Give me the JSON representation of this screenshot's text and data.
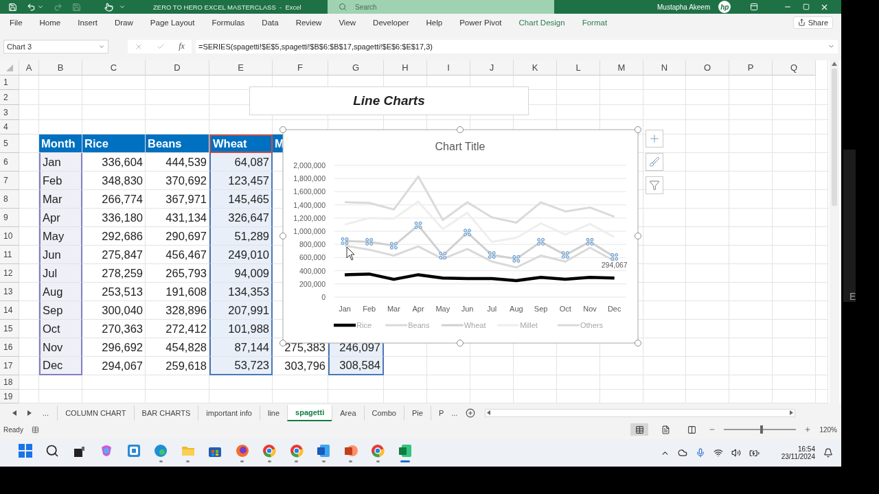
{
  "title_bar": {
    "title": "ZERO TO HERO EXCEL MASTERCLASS  -  Excel",
    "search_placeholder": "Search",
    "user_name": "Mustapha Akeem",
    "account_logo": "hp"
  },
  "ribbon": {
    "tabs": [
      {
        "label": "File",
        "kind": "standard"
      },
      {
        "label": "Home",
        "kind": "standard"
      },
      {
        "label": "Insert",
        "kind": "standard"
      },
      {
        "label": "Draw",
        "kind": "standard"
      },
      {
        "label": "Page Layout",
        "kind": "standard"
      },
      {
        "label": "Formulas",
        "kind": "standard"
      },
      {
        "label": "Data",
        "kind": "standard"
      },
      {
        "label": "Review",
        "kind": "standard"
      },
      {
        "label": "View",
        "kind": "standard"
      },
      {
        "label": "Developer",
        "kind": "standard"
      },
      {
        "label": "Help",
        "kind": "standard"
      },
      {
        "label": "Power Pivot",
        "kind": "standard"
      },
      {
        "label": "Chart Design",
        "kind": "contextual"
      },
      {
        "label": "Format",
        "kind": "contextual"
      }
    ],
    "share": "Share"
  },
  "formula_bar": {
    "name_box": "Chart 3",
    "fx": "fx",
    "formula": "=SERIES(spagetti!$E$5,spagetti!$B$6:$B$17,spagetti!$E$6:$E$17,3)"
  },
  "sheet": {
    "column_letters": [
      "A",
      "B",
      "C",
      "D",
      "E",
      "F",
      "G",
      "H",
      "I",
      "J",
      "K",
      "L",
      "M",
      "N",
      "O",
      "P",
      "Q"
    ],
    "row_numbers": [
      "1",
      "2",
      "3",
      "4",
      "5",
      "6",
      "7",
      "8",
      "9",
      "10",
      "11",
      "12",
      "13",
      "14",
      "15",
      "16",
      "17",
      "18",
      "19"
    ],
    "textbox": "Line Charts",
    "table": {
      "columns": [
        {
          "label": "Month",
          "kind": "category"
        },
        {
          "label": "Rice",
          "kind": "plain"
        },
        {
          "label": "Beans",
          "kind": "plain"
        },
        {
          "label": "Wheat",
          "kind": "series"
        },
        {
          "label": "M",
          "kind": "plain"
        },
        {
          "kind": "series"
        }
      ],
      "rows": [
        {
          "cells": [
            "Jan",
            "336,604",
            "444,539",
            "64,087"
          ]
        },
        {
          "cells": [
            "Feb",
            "348,830",
            "370,692",
            "123,457"
          ]
        },
        {
          "cells": [
            "Mar",
            "266,774",
            "367,971",
            "145,465"
          ]
        },
        {
          "cells": [
            "Apr",
            "336,180",
            "431,134",
            "326,647"
          ]
        },
        {
          "cells": [
            "May",
            "292,686",
            "290,697",
            "51,289"
          ]
        },
        {
          "cells": [
            "Jun",
            "275,847",
            "456,467",
            "249,010"
          ]
        },
        {
          "cells": [
            "Jul",
            "278,259",
            "265,793",
            "94,009"
          ]
        },
        {
          "cells": [
            "Aug",
            "253,513",
            "191,608",
            "134,353"
          ]
        },
        {
          "cells": [
            "Sep",
            "300,040",
            "328,896",
            "207,991"
          ]
        },
        {
          "cells": [
            "Oct",
            "270,363",
            "272,412",
            "101,988"
          ]
        },
        {
          "cells": [
            "Nov",
            "296,692",
            "454,828",
            "87,144",
            "275,383",
            "246,097"
          ]
        },
        {
          "cells": [
            "Dec",
            "294,067",
            "259,618",
            "53,723",
            "303,796",
            "308,584"
          ]
        }
      ]
    },
    "chart": {
      "selected": true,
      "series_states": [
        {
          "selected": false
        },
        {
          "selected": false
        },
        {
          "selected": true
        },
        {
          "selected": false
        },
        {
          "selected": false
        }
      ],
      "chart_data": {
        "type": "line",
        "title": "Chart Title",
        "grid": true,
        "legend": "bottom",
        "categories": [
          "Jan",
          "Feb",
          "Mar",
          "Apr",
          "May",
          "Jun",
          "Jul",
          "Aug",
          "Sep",
          "Oct",
          "Nov",
          "Dec"
        ],
        "series": [
          {
            "name": "Rice",
            "color": "#000000",
            "values": [
              340000,
              350000,
              270000,
              340000,
              290000,
              280000,
              280000,
              250000,
              300000,
              270000,
              300000,
              290000
            ]
          },
          {
            "name": "Beans",
            "color": "#d9d9d9",
            "values": [
              780000,
              720000,
              630000,
              770000,
              580000,
              730000,
              540000,
              450000,
              630000,
              540000,
              750000,
              550000
            ]
          },
          {
            "name": "Wheat",
            "color": "#d0d0d0",
            "values": [
              850000,
              840000,
              780000,
              1090000,
              630000,
              980000,
              640000,
              580000,
              840000,
              640000,
              840000,
              610000
            ]
          },
          {
            "name": "Millet",
            "color": "#eeeeee",
            "values": [
              1100000,
              1200000,
              1190000,
              1450000,
              1030000,
              1280000,
              840000,
              900000,
              1120000,
              950000,
              1110000,
              910000
            ]
          },
          {
            "name": "Others",
            "color": "#dadada",
            "values": [
              1440000,
              1430000,
              1330000,
              1830000,
              1170000,
              1440000,
              1210000,
              1130000,
              1440000,
              1300000,
              1360000,
              1220000
            ]
          }
        ],
        "ylim": [
          0,
          2000000
        ],
        "yticks": [
          {
            "value": 0,
            "label": "0"
          },
          {
            "value": 200000,
            "label": "200,000"
          },
          {
            "value": 400000,
            "label": "400,000"
          },
          {
            "value": 600000,
            "label": "600,000"
          },
          {
            "value": 800000,
            "label": "800,000"
          },
          {
            "value": 1000000,
            "label": "1,000,000"
          },
          {
            "value": 1200000,
            "label": "1,200,000"
          },
          {
            "value": 1400000,
            "label": "1,400,000"
          },
          {
            "value": 1600000,
            "label": "1,600,000"
          },
          {
            "value": 1800000,
            "label": "1,800,000"
          },
          {
            "value": 2000000,
            "label": "2,000,000"
          }
        ],
        "annotations": [
          {
            "x": "Dec",
            "text": "294,067"
          }
        ]
      }
    }
  },
  "sheet_tabs": {
    "more": "...",
    "tabs": [
      {
        "label": "COLUMN CHART",
        "selected": false
      },
      {
        "label": "BAR CHARTS",
        "selected": false
      },
      {
        "label": "important info",
        "selected": false
      },
      {
        "label": "line",
        "selected": false
      },
      {
        "label": "spagetti",
        "selected": true
      },
      {
        "label": "Area",
        "selected": false
      },
      {
        "label": "Combo",
        "selected": false
      },
      {
        "label": "Pie",
        "selected": false
      },
      {
        "label": "P",
        "selected": false
      }
    ],
    "overflow": "..."
  },
  "status_bar": {
    "status": "Ready",
    "view_buttons": [
      {
        "kind": "normal",
        "selected": true
      },
      {
        "kind": "layout",
        "selected": false
      },
      {
        "kind": "pagebreak",
        "selected": false
      }
    ],
    "zoom": {
      "level": 0.52,
      "reading": "120%"
    }
  },
  "taskbar": {
    "apps": [
      {
        "kind": "start",
        "running": false,
        "active": false
      },
      {
        "kind": "search",
        "running": false,
        "active": false
      },
      {
        "kind": "taskview",
        "running": false,
        "active": false
      },
      {
        "kind": "copilot",
        "running": false,
        "active": false
      },
      {
        "kind": "widgets",
        "running": false,
        "active": false
      },
      {
        "kind": "edge",
        "running": true,
        "active": false
      },
      {
        "kind": "explorer",
        "running": true,
        "active": false
      },
      {
        "kind": "store",
        "running": false,
        "active": false
      },
      {
        "kind": "firefox",
        "running": true,
        "active": false
      },
      {
        "kind": "chrome",
        "running": true,
        "active": false
      },
      {
        "kind": "chrome",
        "running": true,
        "active": false
      },
      {
        "kind": "word",
        "running": true,
        "active": false
      },
      {
        "kind": "powerpoint",
        "running": true,
        "active": false
      },
      {
        "kind": "chrome",
        "running": true,
        "active": false
      },
      {
        "kind": "excel",
        "running": true,
        "active": true
      }
    ],
    "time": "16:54",
    "date": "23/11/2024"
  },
  "edge_letter": "E"
}
